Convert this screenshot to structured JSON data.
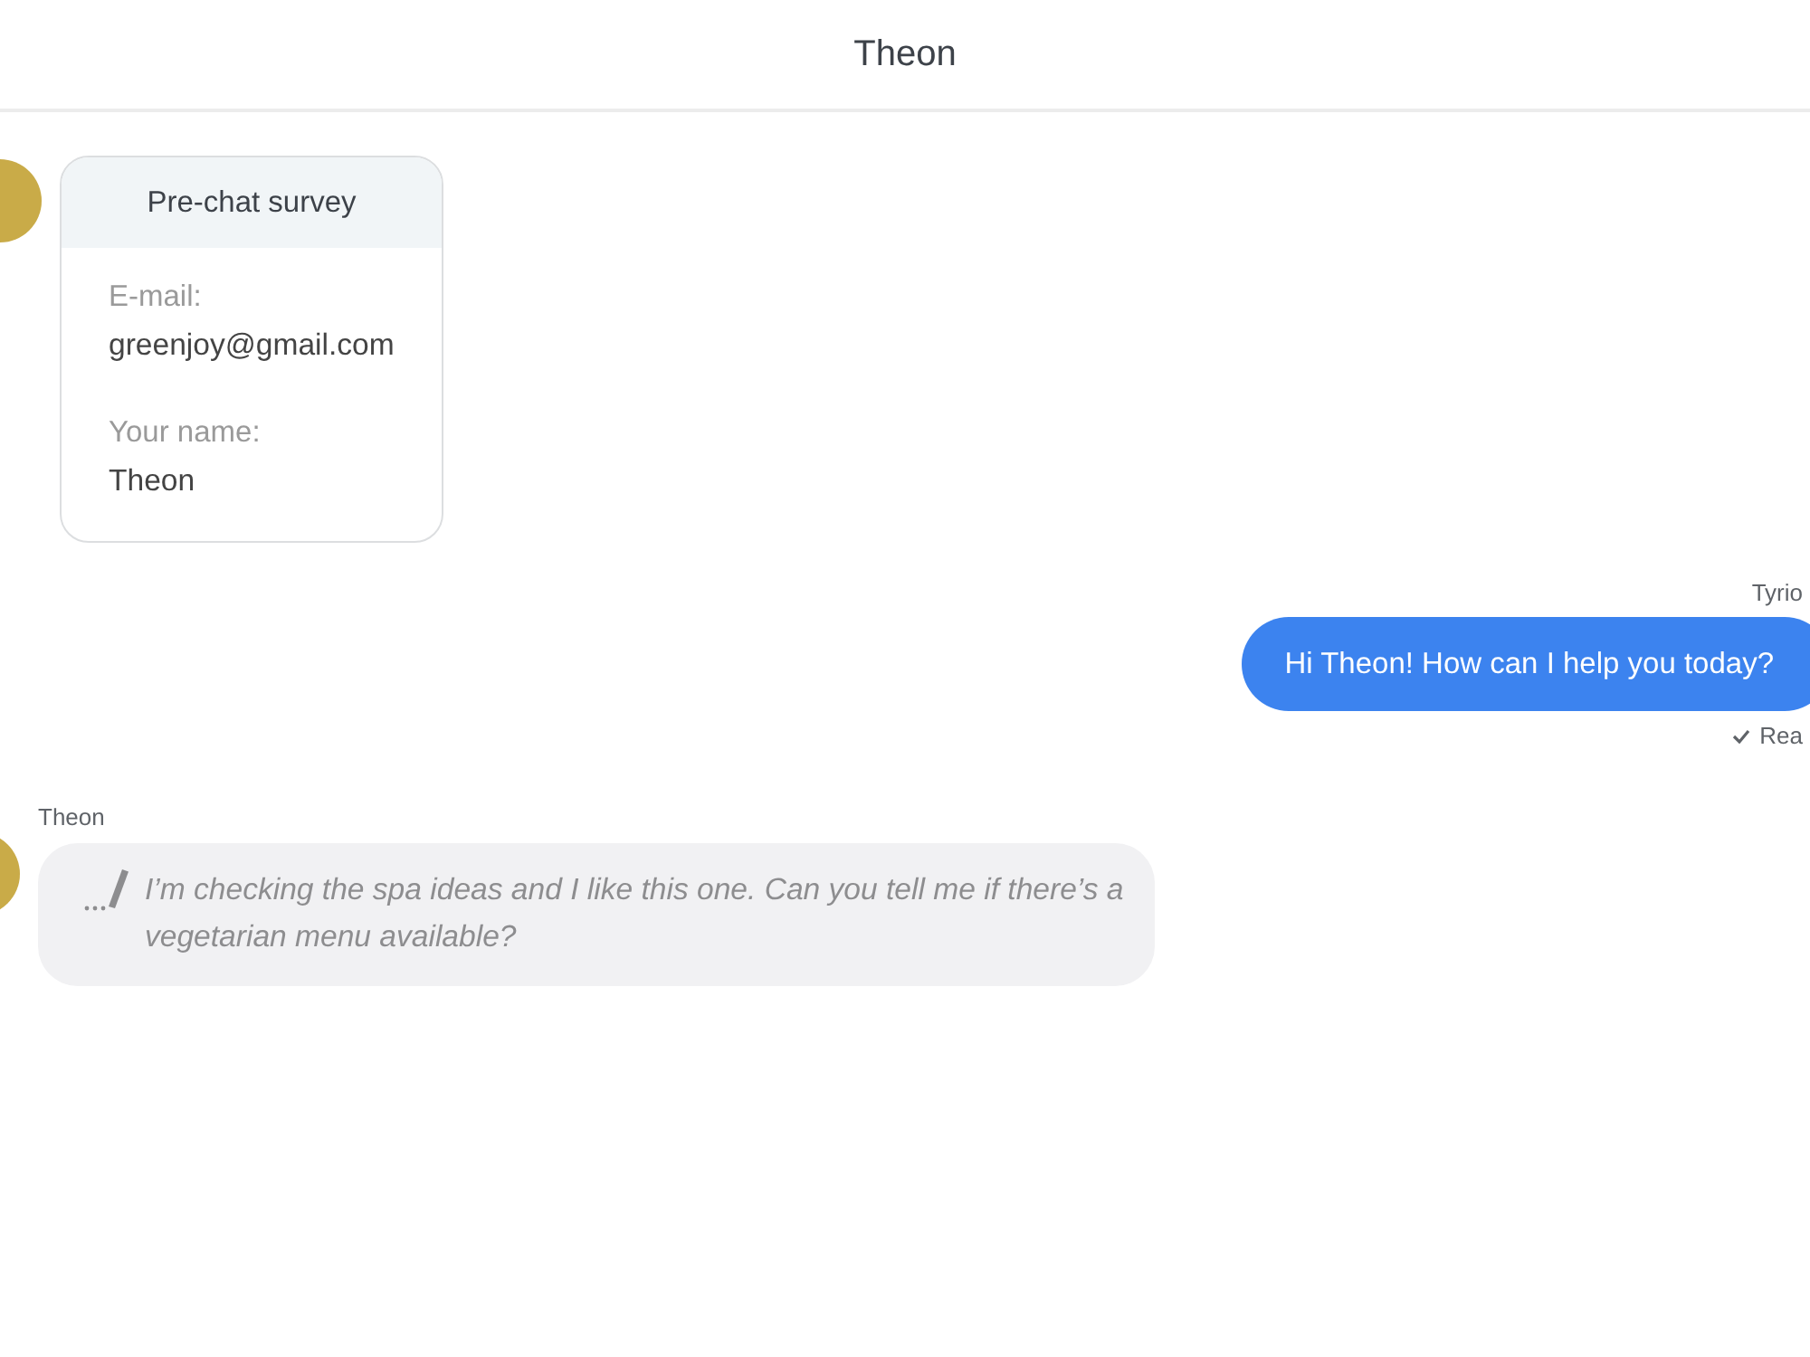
{
  "header": {
    "title": "Theon"
  },
  "messages": [
    {
      "kind": "survey",
      "outgoing": false,
      "title": "Pre-chat survey",
      "fields": [
        {
          "label": "E-mail:",
          "value": "greenjoy@gmail.com"
        },
        {
          "label": "Your name:",
          "value": "Theon"
        }
      ]
    },
    {
      "kind": "text",
      "outgoing": true,
      "sender": "Tyrio",
      "text": "Hi Theon! How can I help you today?",
      "read": true,
      "status": "Rea"
    },
    {
      "kind": "typing",
      "outgoing": false,
      "sender": "Theon",
      "text": "I’m checking the spa ideas and I like this one. Can you tell me if there’s a vegetarian menu available?"
    }
  ]
}
